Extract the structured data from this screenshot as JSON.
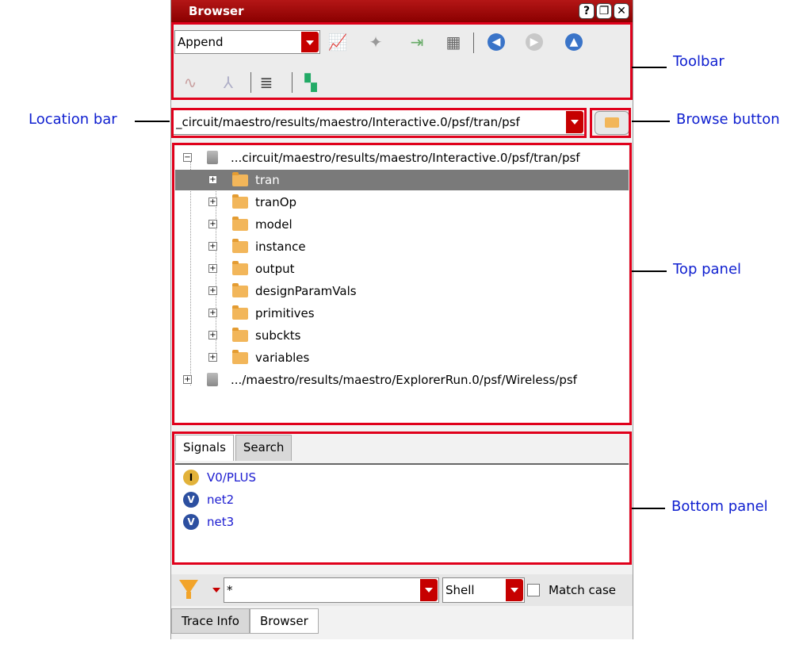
{
  "window": {
    "title": "Browser",
    "title_buttons": [
      "?",
      "❐",
      "✕"
    ]
  },
  "toolbar": {
    "mode_value": "Append"
  },
  "location": {
    "path": "_circuit/maestro/results/maestro/Interactive.0/psf/tran/psf"
  },
  "tree": {
    "root1": "...circuit/maestro/results/maestro/Interactive.0/psf/tran/psf",
    "children": [
      "tran",
      "tranOp",
      "model",
      "instance",
      "output",
      "designParamVals",
      "primitives",
      "subckts",
      "variables"
    ],
    "root2": ".../maestro/results/maestro/ExplorerRun.0/psf/Wireless/psf"
  },
  "bottom": {
    "tabs": [
      "Signals",
      "Search"
    ],
    "signals": [
      {
        "name": "V0/PLUS",
        "icon": "I",
        "color": "#000000"
      },
      {
        "name": "net2",
        "icon": "V",
        "color": "#1a1ad0"
      },
      {
        "name": "net3",
        "icon": "V",
        "color": "#1a1ad0"
      }
    ]
  },
  "filter": {
    "value": "*",
    "shell": "Shell",
    "match_case": "Match case"
  },
  "bottom_tabs": [
    "Trace Info",
    "Browser"
  ],
  "annotations": {
    "toolbar": "Toolbar",
    "location_bar": "Location bar",
    "browse_button": "Browse button",
    "top_panel": "Top panel",
    "bottom_panel": "Bottom panel"
  }
}
